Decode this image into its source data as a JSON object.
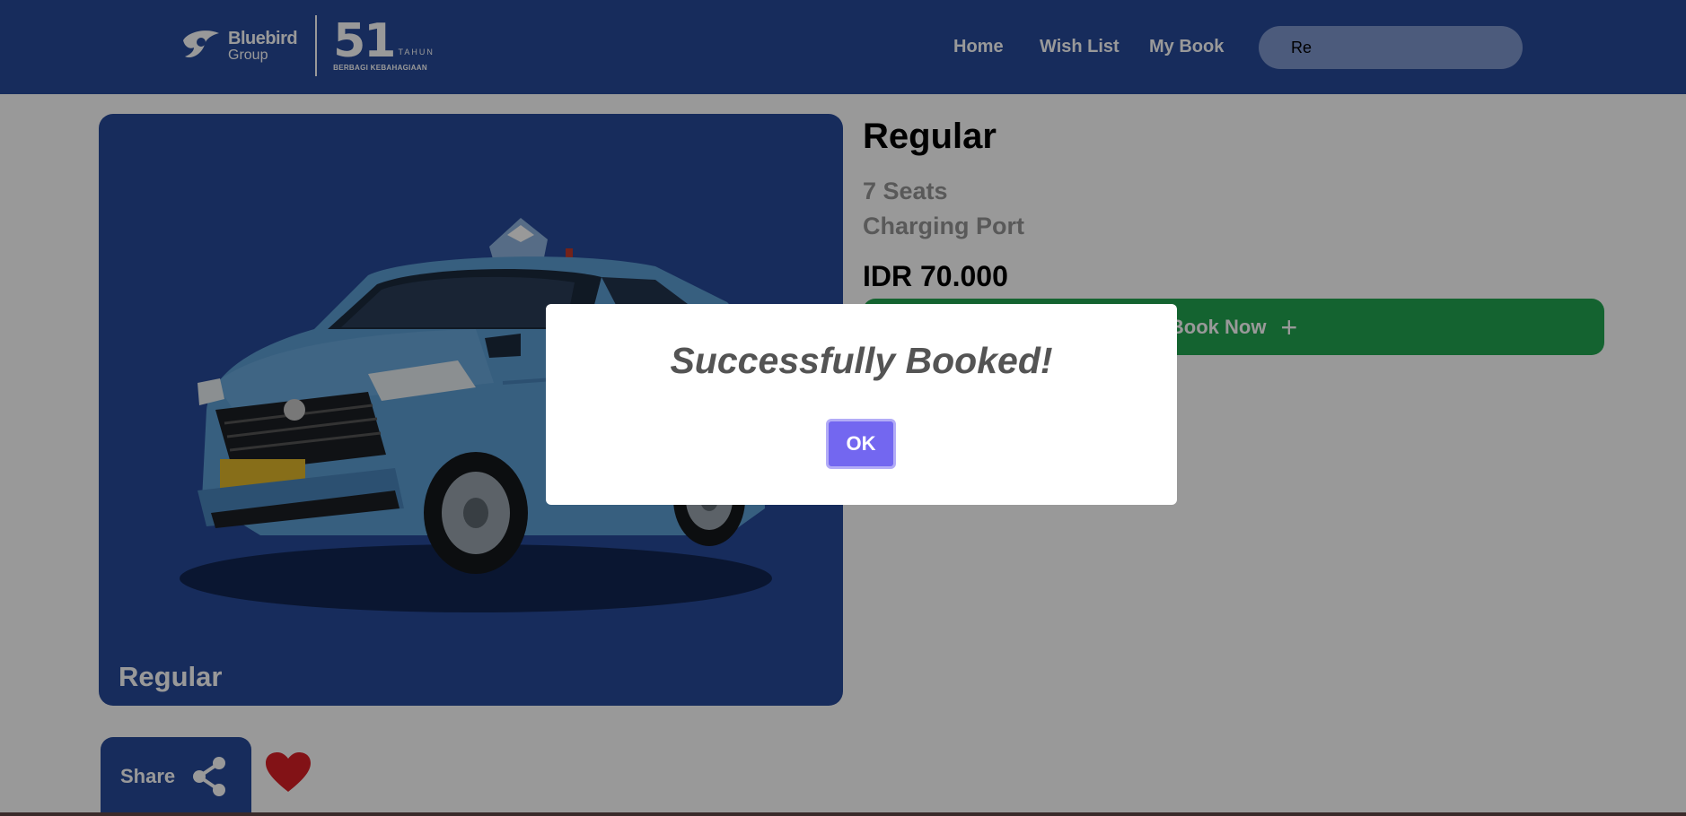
{
  "header": {
    "logo": {
      "brand": "Bluebird",
      "group": "Group",
      "anniversary_number": "51",
      "anniversary_tahun": "TAHUN",
      "anniversary_tagline": "BERBAGI KEBAHAGIAAN"
    },
    "nav": [
      {
        "label": "Home"
      },
      {
        "label": "Wish List"
      },
      {
        "label": "My Book"
      }
    ],
    "search": {
      "value": "Re"
    }
  },
  "product": {
    "card_label": "Regular",
    "title": "Regular",
    "features": [
      "7 Seats",
      "Charging Port"
    ],
    "price": "IDR 70.000",
    "book_label": "Book Now",
    "book_icon": "plus-icon",
    "share_label": "Share",
    "share_icon": "share-icon",
    "favorite_icon": "heart-icon"
  },
  "dialog": {
    "title": "Successfully Booked!",
    "ok_label": "OK"
  },
  "colors": {
    "header_bg": "#274a99",
    "card_bg": "#274a99",
    "book_button": "#22a650",
    "ok_button": "#7367f0",
    "heart": "#d91f26",
    "overlay": "rgba(0,0,0,0.4)"
  }
}
